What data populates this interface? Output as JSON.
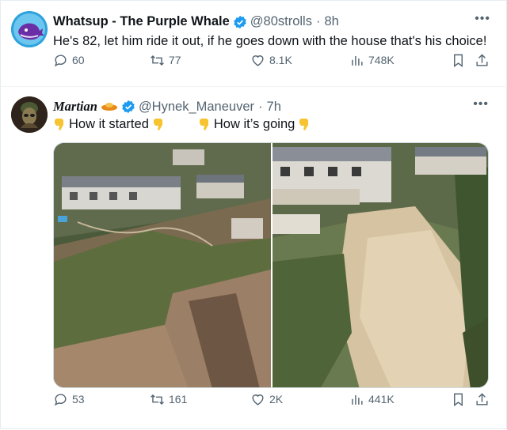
{
  "tweets": [
    {
      "display_name": "Whatsup - The Purple Whale",
      "handle": "@80strolls",
      "time": "8h",
      "text": "He's 82, let him ride it out, if he goes down with the house that's his choice!",
      "stats": {
        "replies": "60",
        "retweets": "77",
        "likes": "8.1K",
        "views": "748K"
      }
    },
    {
      "display_name": "Martian",
      "handle": "@Hynek_Maneuver",
      "time": "7h",
      "text_left": "How it started",
      "text_right": "How it’s going",
      "stats": {
        "replies": "53",
        "retweets": "161",
        "likes": "2K",
        "views": "441K"
      }
    }
  ],
  "icons": {
    "verified": "verified-badge-icon",
    "reply": "reply-icon",
    "retweet": "retweet-icon",
    "like": "heart-icon",
    "views": "analytics-icon",
    "bookmark": "bookmark-icon",
    "share": "share-icon",
    "more": "more-icon",
    "emoji": "pointing-down-emoji-icon"
  },
  "colors": {
    "verified": "#1d9bf0",
    "muted": "#536471",
    "text": "#0f1419"
  }
}
